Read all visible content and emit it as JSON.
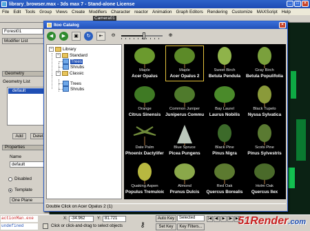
{
  "window": {
    "title": "library_browser.max - 3ds max 7 - Stand-alone License"
  },
  "menu": [
    "File",
    "Edit",
    "Tools",
    "Group",
    "Views",
    "Create",
    "Modifiers",
    "Character",
    "reactor",
    "Animation",
    "Graph Editors",
    "Rendering",
    "Customize",
    "MAXScript",
    "Help"
  ],
  "viewport_label": "Camera01",
  "left_panel": {
    "object_name": "Forest01",
    "modifier_list": "Modifier List",
    "rollout_geometry": "Geometry",
    "geometry_list_label": "Geometry List",
    "list_selected": "default",
    "add_button": "Add",
    "delete_button": "Delete",
    "properties_rollout": "Properties",
    "name_label": "Name",
    "name_value": "default",
    "disabled_label": "Disabled",
    "template_label": "Template",
    "template_value": "One Plane"
  },
  "dialog": {
    "title": "Itoo Catalog",
    "tree": {
      "root": "Library",
      "standard": "Standard",
      "standard_trees": "Trees",
      "standard_shrubs": "Shrubs",
      "classic": "Classic",
      "classic_trees": "Trees",
      "classic_shrubs": "Shrubs"
    },
    "zoom_level": 0.55,
    "items": [
      {
        "common": "Maple",
        "latin": "Acer Opalus",
        "color": "#6b9a2e",
        "shape": "round"
      },
      {
        "common": "Maple",
        "latin": "Acer Opalus 2",
        "color": "#5c8a28",
        "shape": "round"
      },
      {
        "common": "Sweet Birch",
        "latin": "Betula Pendula",
        "color": "#8fb34a",
        "shape": "oval"
      },
      {
        "common": "Gray Birch",
        "latin": "Betula Populifolia",
        "color": "#7aa03c",
        "shape": "oval"
      },
      {
        "common": "Orange",
        "latin": "Citrus Sinensis",
        "color": "#3f7a24",
        "shape": "round"
      },
      {
        "common": "Common Juniper",
        "latin": "Juniperus Communis",
        "color": "#4f7a2c",
        "shape": "round"
      },
      {
        "common": "Bay Laurel",
        "latin": "Laurus Nobilis",
        "color": "#4a8a2a",
        "shape": "round"
      },
      {
        "common": "Black Tupelo",
        "latin": "Nyssa Sylvatica",
        "color": "#8a9a3a",
        "shape": "oval"
      },
      {
        "common": "Date Palm",
        "latin": "Phoenix Dactylifera",
        "color": "#6f8a3a",
        "shape": "palm"
      },
      {
        "common": "Blue Spruce",
        "latin": "Picea Pungens",
        "color": "#bcc8bc",
        "shape": "cone"
      },
      {
        "common": "Black Pine",
        "latin": "Pinus Nigra",
        "color": "#3c6a2a",
        "shape": "oval"
      },
      {
        "common": "Scots Pine",
        "latin": "Pinus Sylvestris",
        "color": "#5a7a32",
        "shape": "oval"
      },
      {
        "common": "Quaking Aspen",
        "latin": "Populus Tremuloides",
        "color": "#b8b840",
        "shape": "oval"
      },
      {
        "common": "Almond",
        "latin": "Prunus Dulcis",
        "color": "#8aa84a",
        "shape": "round"
      },
      {
        "common": "Red Oak",
        "latin": "Quercus Borealis",
        "color": "#5c7a30",
        "shape": "round"
      },
      {
        "common": "Holm Oak",
        "latin": "Quercus Ilex",
        "color": "#4a6a2a",
        "shape": "round"
      }
    ],
    "status": "Double Click on Acer Opalus 2 (1)"
  },
  "bottom": {
    "script_line1": "actionMan.exe",
    "script_line2": "undefined",
    "prompt": "Click or click-and-drag to select objects",
    "x_label": "X:",
    "x_value": "-34.962",
    "y_label": "Y:",
    "y_value": "81.721",
    "auto_key": "Auto Key",
    "set_key": "Set Key",
    "selection_value": "Selected",
    "key_filters": "Key Filters..."
  },
  "watermark": {
    "main": "51Render",
    "suffix": ".com"
  }
}
